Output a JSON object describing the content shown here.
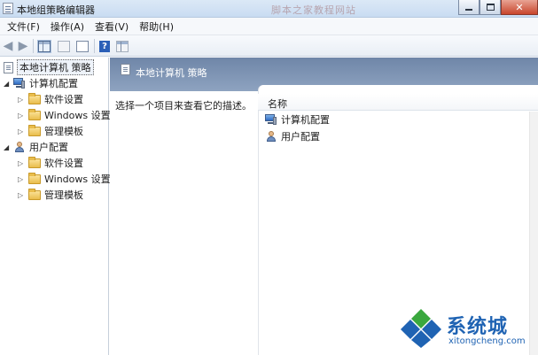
{
  "window": {
    "title": "本地组策略编辑器",
    "controls": [
      "minimize",
      "maximize",
      "close"
    ]
  },
  "menu": [
    "文件(F)",
    "操作(A)",
    "查看(V)",
    "帮助(H)"
  ],
  "toolbar": {
    "icons": [
      "back-arrow-icon",
      "forward-arrow-icon",
      "show-hide-tree-icon",
      "properties-icon",
      "export-list-icon",
      "help-icon",
      "show-hide-action-pane-icon"
    ]
  },
  "tree": {
    "root": "本地计算机 策略",
    "computer": {
      "label": "计算机配置",
      "children": [
        "软件设置",
        "Windows 设置",
        "管理模板"
      ]
    },
    "user": {
      "label": "用户配置",
      "children": [
        "软件设置",
        "Windows 设置",
        "管理模板"
      ]
    }
  },
  "content": {
    "header_title": "本地计算机 策略",
    "description": "选择一个项目来查看它的描述。",
    "column_name": "名称",
    "items": [
      "计算机配置",
      "用户配置"
    ]
  },
  "watermark": {
    "top_text": "脚本之家教程网站",
    "brand": "系统城",
    "url": "xitongcheng.com",
    "colors": {
      "blue": "#1f63b3",
      "green": "#3aa83e"
    }
  }
}
